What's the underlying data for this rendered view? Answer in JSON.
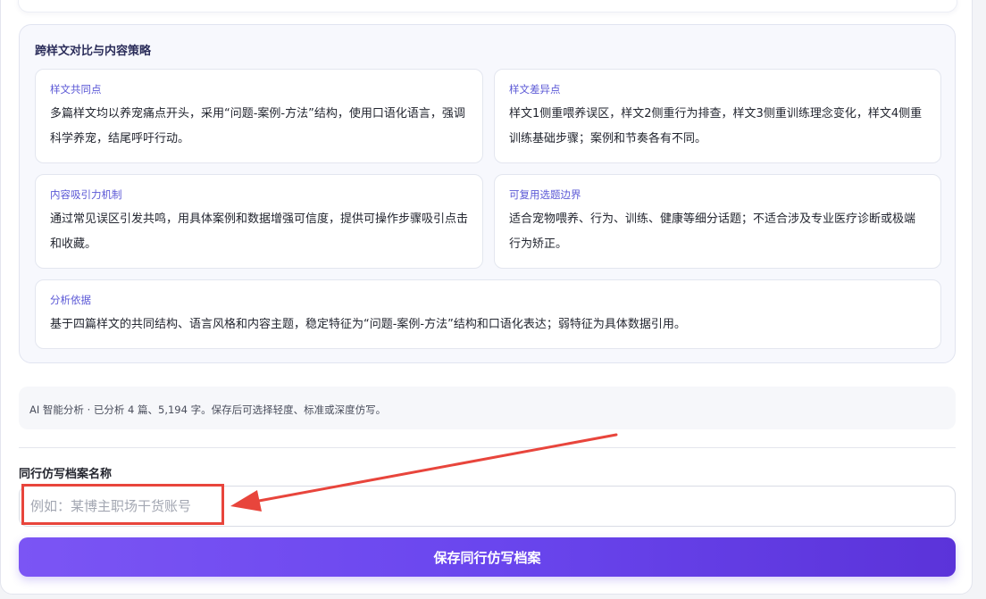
{
  "analysis_section": {
    "title": "跨样文对比与内容策略",
    "cards": [
      {
        "label": "样文共同点",
        "text": "多篇样文均以养宠痛点开头，采用“问题-案例-方法”结构，使用口语化语言，强调科学养宠，结尾呼吁行动。"
      },
      {
        "label": "样文差异点",
        "text": "样文1侧重喂养误区，样文2侧重行为排查，样文3侧重训练理念变化，样文4侧重训练基础步骤；案例和节奏各有不同。"
      },
      {
        "label": "内容吸引力机制",
        "text": "通过常见误区引发共鸣，用具体案例和数据增强可信度，提供可操作步骤吸引点击和收藏。"
      },
      {
        "label": "可复用选题边界",
        "text": "适合宠物喂养、行为、训练、健康等细分话题；不适合涉及专业医疗诊断或极端行为矫正。"
      },
      {
        "label": "分析依据",
        "text": "基于四篇样文的共同结构、语言风格和内容主题，稳定特征为“问题-案例-方法”结构和口语化表达；弱特征为具体数据引用。"
      }
    ]
  },
  "info": {
    "text": "AI 智能分析 · 已分析 4 篇、5,194 字。保存后可选择轻度、标准或深度仿写。"
  },
  "profile_form": {
    "label": "同行仿写档案名称",
    "input_value": "",
    "placeholder": "例如：某博主职场干货账号",
    "save_button": "保存同行仿写档案"
  },
  "colors": {
    "accent": "#6a46ee",
    "annotation": "#e8453c",
    "card_label": "#5b58d6"
  }
}
